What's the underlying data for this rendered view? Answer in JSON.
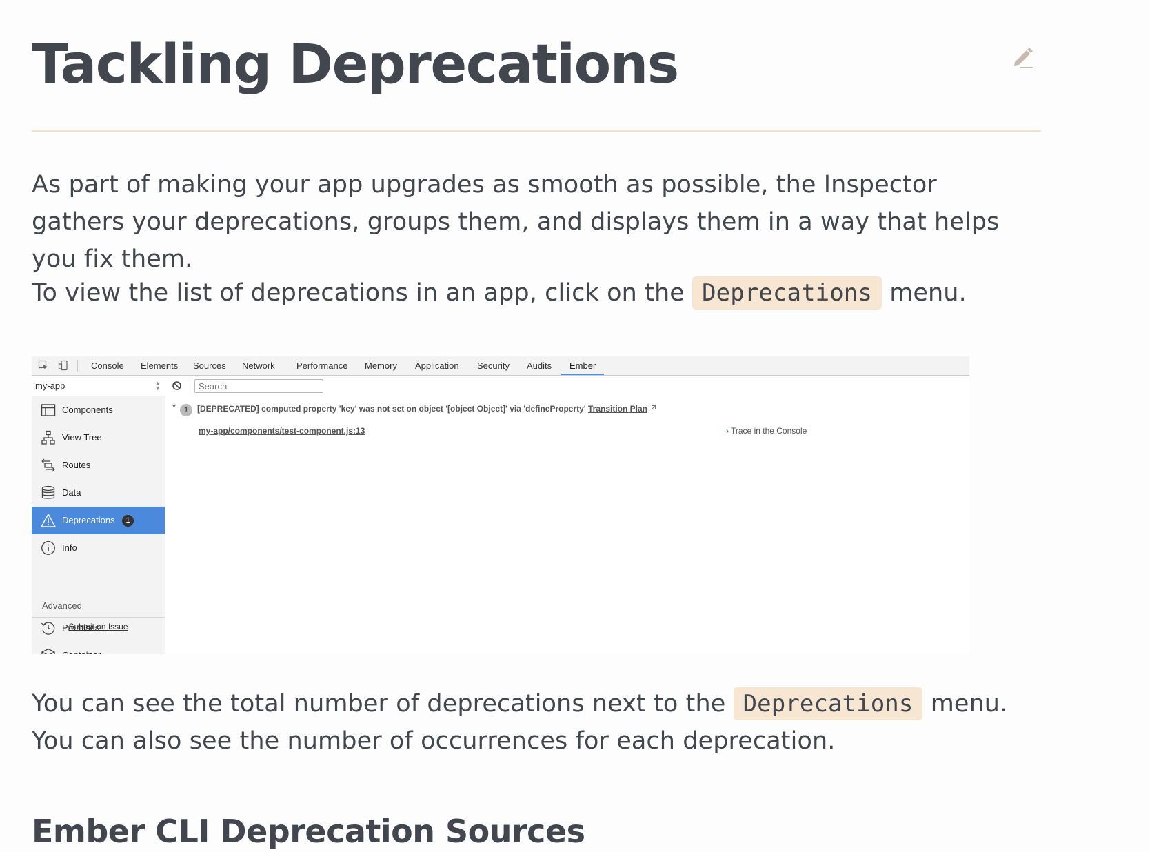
{
  "title": "Tackling Deprecations",
  "paragraphs": {
    "intro": "As part of making your app upgrades as smooth as possible, the Inspector gathers your deprecations, groups them, and displays them in a way that helps you fix them.",
    "p2_before": "To view the list of deprecations in an app, click on the",
    "p2_code": "Deprecations",
    "p2_after": "menu.",
    "p3_before": "You can see the total number of deprecations next to the",
    "p3_code": "Deprecations",
    "p3_after": "menu. You can also see the number of occurrences for each deprecation."
  },
  "next_heading": "Ember CLI Deprecation Sources",
  "devtools": {
    "tabs": [
      "Console",
      "Elements",
      "Sources",
      "Network",
      "Performance",
      "Memory",
      "Application",
      "Security",
      "Audits",
      "Ember"
    ],
    "active_tab": "Ember",
    "app_select": "my-app",
    "search_placeholder": "Search",
    "nav": [
      {
        "label": "Components",
        "icon": "components-icon"
      },
      {
        "label": "View Tree",
        "icon": "view-tree-icon"
      },
      {
        "label": "Routes",
        "icon": "routes-icon"
      },
      {
        "label": "Data",
        "icon": "data-icon"
      },
      {
        "label": "Deprecations",
        "icon": "warning-icon",
        "badge": "1",
        "active": true
      },
      {
        "label": "Info",
        "icon": "info-icon"
      },
      {
        "label": "Promises",
        "icon": "promises-icon"
      },
      {
        "label": "Container",
        "icon": "container-icon"
      }
    ],
    "advanced_label": "Advanced",
    "submit_issue": "Submit an Issue",
    "deprecation": {
      "count": "1",
      "message": "[DEPRECATED] computed property 'key' was not set on object '[object Object]' via 'defineProperty'",
      "link": "Transition Plan",
      "source": "my-app/components/test-component.js:13",
      "trace": "Trace in the Console"
    }
  },
  "colors": {
    "text": "#42474f",
    "code_bg": "#f7e7d2",
    "rule": "#f1e3c6",
    "active_nav": "#4a89dc",
    "tab_underline": "#4a90e2"
  }
}
